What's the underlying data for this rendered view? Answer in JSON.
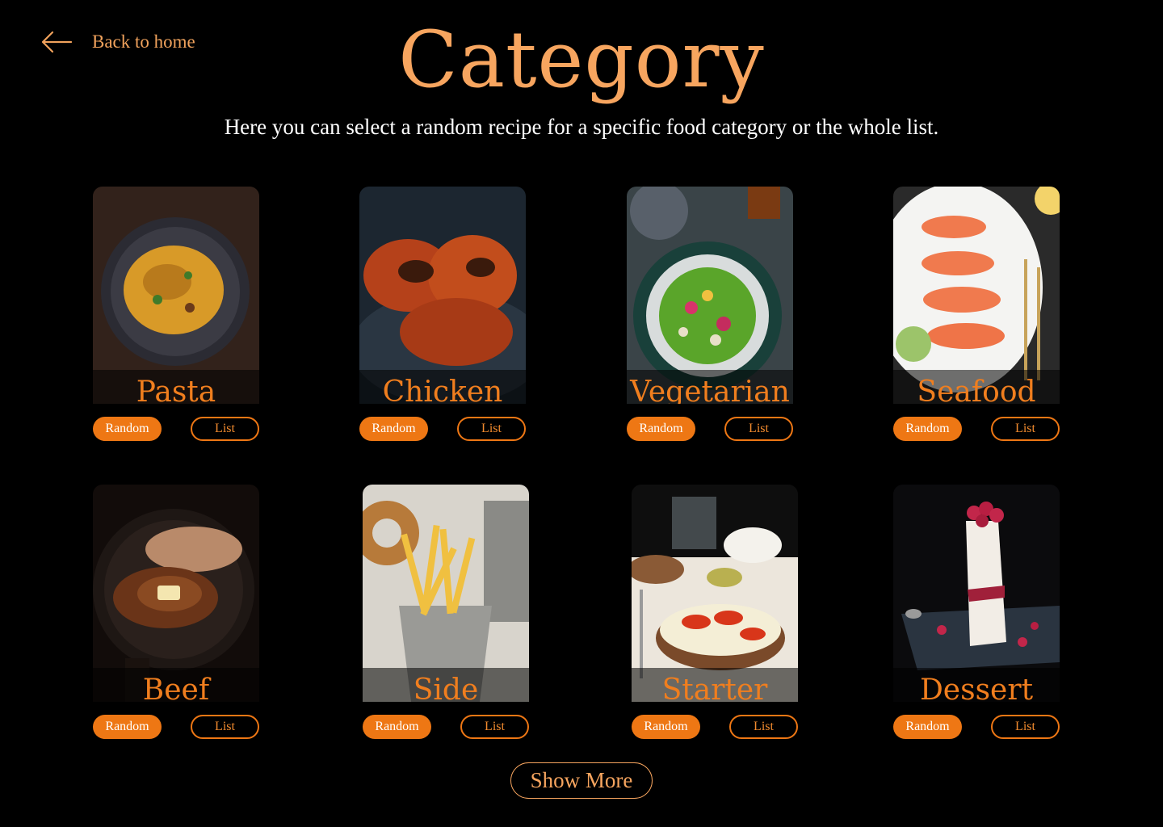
{
  "header": {
    "back_label": "Back to home",
    "title": "Category",
    "subtitle": "Here you can select a random recipe for a specific food category or the whole list."
  },
  "buttons": {
    "random_label": "Random",
    "list_label": "List",
    "show_more_label": "Show More"
  },
  "categories": [
    {
      "name": "Pasta",
      "image": "pasta-dish-image"
    },
    {
      "name": "Chicken",
      "image": "grilled-chicken-image"
    },
    {
      "name": "Vegetarian",
      "image": "vegetarian-bowl-image"
    },
    {
      "name": "Seafood",
      "image": "shrimp-platter-image"
    },
    {
      "name": "Beef",
      "image": "steak-skillet-image"
    },
    {
      "name": "Side",
      "image": "french-fries-image"
    },
    {
      "name": "Starter",
      "image": "bruschetta-image"
    },
    {
      "name": "Dessert",
      "image": "berry-parfait-image"
    }
  ],
  "colors": {
    "background": "#000000",
    "accent": "#ee7714",
    "title": "#f7a55f",
    "text": "#ffffff"
  }
}
